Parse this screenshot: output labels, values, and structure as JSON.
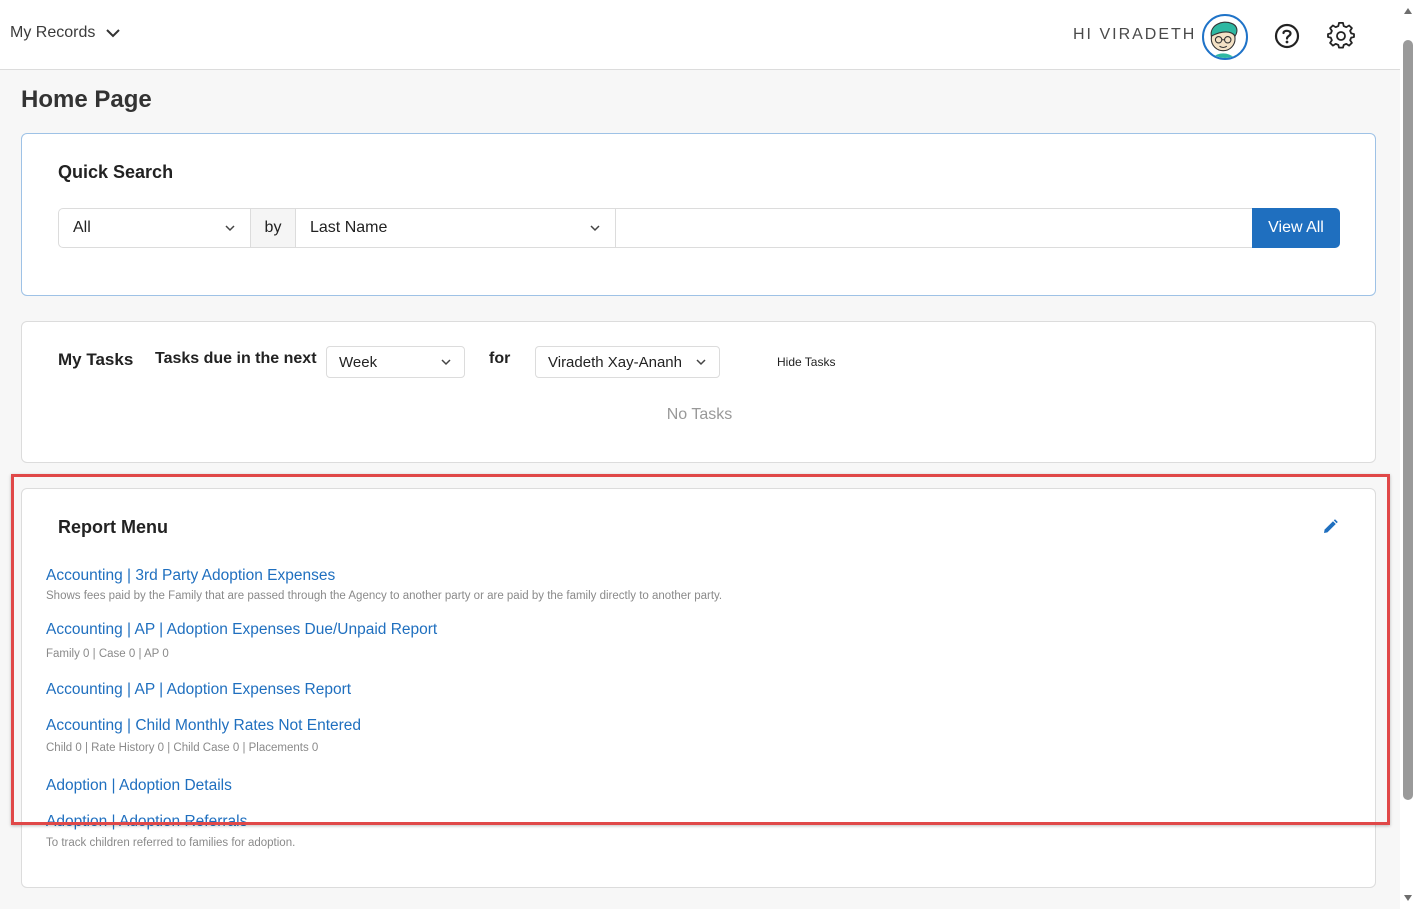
{
  "topbar": {
    "records_label": "My Records",
    "greeting": "HI VIRADETH"
  },
  "page_title": "Home Page",
  "quick_search": {
    "title": "Quick Search",
    "scope": "All",
    "by_label": "by",
    "field": "Last Name",
    "input_value": "",
    "button_label": "View All"
  },
  "tasks": {
    "title": "My Tasks",
    "due_label": "Tasks due in the next",
    "period": "Week",
    "for_label": "for",
    "person": "Viradeth Xay-Ananh",
    "hide_label": "Hide Tasks",
    "empty_text": "No Tasks"
  },
  "report_menu": {
    "title": "Report Menu",
    "items": [
      {
        "label": "Accounting | 3rd Party Adoption Expenses",
        "desc": "Shows fees paid by the Family that are passed through the Agency to another party or are paid by the family directly to another party."
      },
      {
        "label": "Accounting | AP | Adoption Expenses Due/Unpaid Report",
        "desc": "Family 0 | Case 0 | AP 0"
      },
      {
        "label": "Accounting | AP | Adoption Expenses Report",
        "desc": ""
      },
      {
        "label": "Accounting | Child Monthly Rates Not Entered",
        "desc": "Child 0 | Rate History 0 | Child Case 0 | Placements 0"
      },
      {
        "label": "Adoption | Adoption Details",
        "desc": ""
      },
      {
        "label": "Adoption | Adoption Referrals",
        "desc": "To track children referred to families for adoption."
      }
    ]
  },
  "colors": {
    "accent": "#1f6fbf",
    "highlight": "#e04848"
  }
}
